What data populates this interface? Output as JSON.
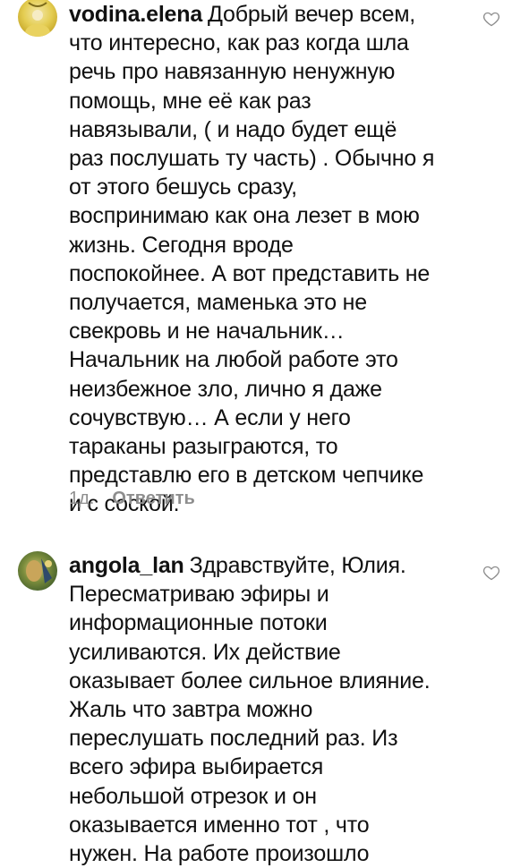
{
  "comments": [
    {
      "username": "vodina.elena",
      "lines": [
        "Добрый вечер всем,",
        "что интересно, как раз когда шла",
        "речь про навязанную ненужную",
        "помощь, мне её как раз",
        "навязывали, ( и  надо будет ещё",
        "раз послушать ту часть) . Обычно я",
        "от этого бешусь сразу,",
        "воспринимаю как она лезет в мою",
        "жизнь. Сегодня вроде",
        "поспокойнее. А вот представить не",
        "получается, маменька это не",
        "свекровь и не начальник…",
        "Начальник на любой работе это",
        "неизбежное зло, лично я даже",
        "сочувствую… А если у него",
        "тараканы разыграются, то",
        "представлю его в детском чепчике",
        "и с соской."
      ],
      "time": "1д.",
      "reply_label": "Ответить"
    },
    {
      "username": "angola_lan",
      "lines": [
        "Здравствуйте, Юлия.",
        "Пересматриваю эфиры  и",
        "информационные потоки",
        "усиливаются. Их действие",
        "оказывает более сильное влияние.",
        "Жаль что завтра можно",
        "переслушать последний раз. Из",
        "всего эфира выбирается",
        "небольшой отрезок и он",
        "оказывается именно тот , что",
        "нужен. На работе произошло"
      ]
    }
  ],
  "icons": {
    "like": "heart-icon",
    "avatar1": "avatar-yellow",
    "avatar2": "avatar-green"
  },
  "colors": {
    "text": "#111111",
    "meta": "#8e8e8e"
  }
}
